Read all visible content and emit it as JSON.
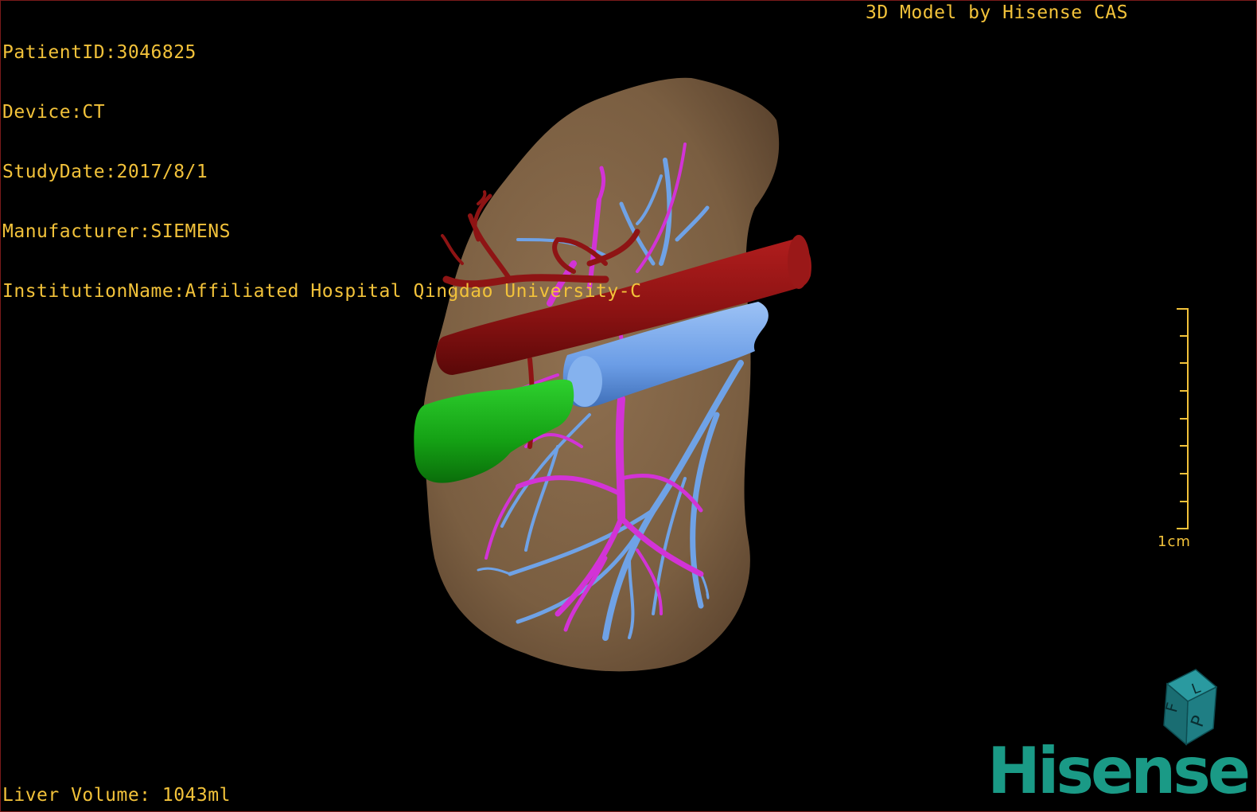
{
  "patient_info": {
    "patient_id": "PatientID:3046825",
    "device": "Device:CT",
    "study_date": "StudyDate:2017/8/1",
    "manufacturer": "Manufacturer:SIEMENS",
    "institution": "InstitutionName:Affiliated Hospital Qingdao University-C"
  },
  "model_credit": "3D Model by Hisense CAS",
  "liver_volume": "Liver Volume: 1043ml",
  "scale": {
    "label": "1cm"
  },
  "orientation_cube": {
    "labels": [
      "F",
      "L",
      "P"
    ]
  },
  "brand": "Hisense",
  "colors": {
    "overlay_text": "#f2c23a",
    "liver": "#8a6b4a",
    "artery": "#8e1414",
    "portal_vein": "#d233d6",
    "hepatic_vein": "#6fa2e6",
    "gallbladder": "#1aa01a",
    "brand": "#1a9a86"
  }
}
